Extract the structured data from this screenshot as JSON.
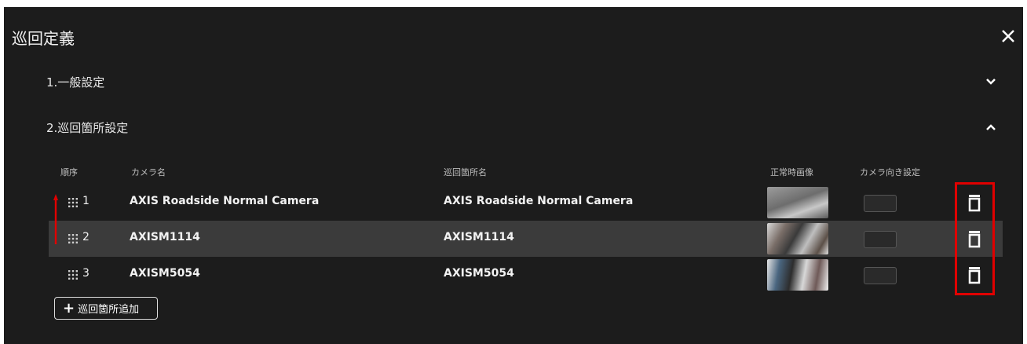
{
  "dialog": {
    "title": "巡回定義"
  },
  "sections": {
    "general": {
      "label": "1.一般設定"
    },
    "patrol_points": {
      "label": "2.巡回箇所設定"
    }
  },
  "table": {
    "headers": {
      "order": "順序",
      "camera_name": "カメラ名",
      "patrol_point_name": "巡回箇所名",
      "normal_image": "正常時画像",
      "camera_direction": "カメラ向き設定"
    },
    "rows": [
      {
        "order": "1",
        "camera_name": "AXIS Roadside Normal Camera",
        "patrol_point_name": "AXIS Roadside Normal Camera"
      },
      {
        "order": "2",
        "camera_name": "AXISM1114",
        "patrol_point_name": "AXISM1114"
      },
      {
        "order": "3",
        "camera_name": "AXISM5054",
        "patrol_point_name": "AXISM5054"
      }
    ]
  },
  "add_button": {
    "label": "巡回箇所追加"
  },
  "colors": {
    "background": "#1c1c1c",
    "selected_row": "#3b3b3b",
    "annotation_red": "#e00000"
  },
  "icons": {
    "close": "close-icon",
    "expand": "chevron-down-icon",
    "collapse": "chevron-up-icon",
    "drag": "drag-grip-icon",
    "delete": "trash-icon",
    "add": "plus-icon"
  }
}
